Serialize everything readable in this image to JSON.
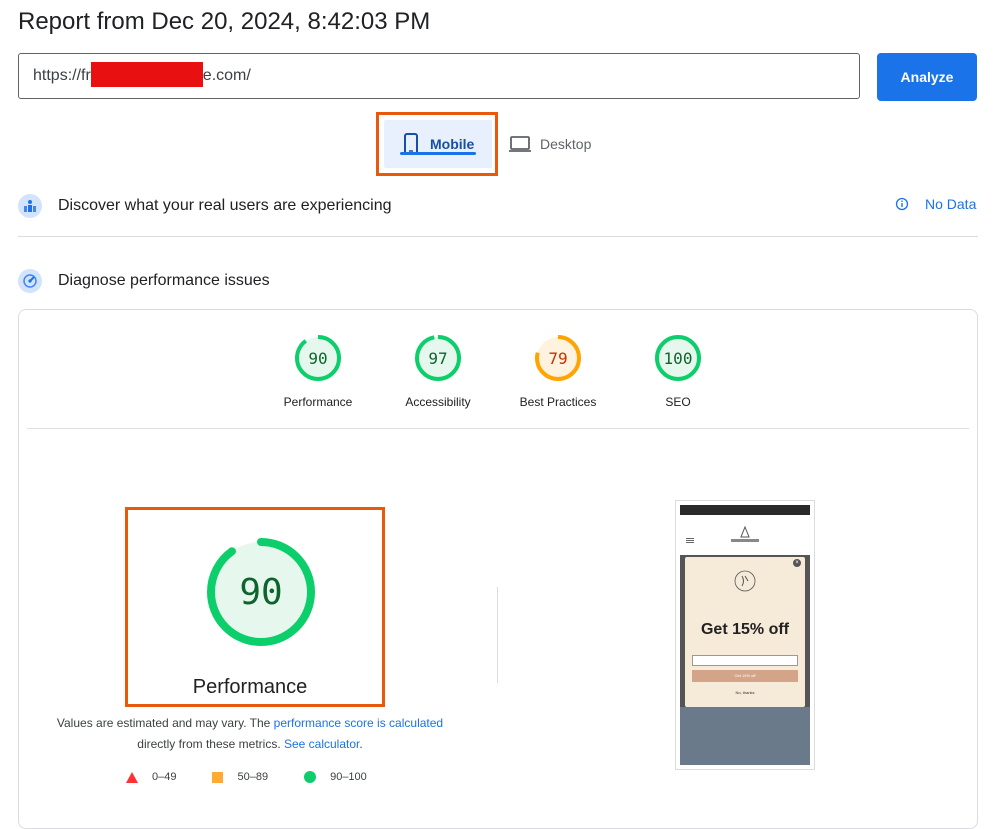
{
  "header": {
    "title": "Report from Dec 20, 2024, 8:42:03 PM"
  },
  "url_bar": {
    "value_prefix": "https://fr",
    "value_suffix": "e.com/",
    "analyze_label": "Analyze"
  },
  "device_tabs": [
    {
      "label": "Mobile",
      "selected": true
    },
    {
      "label": "Desktop",
      "selected": false
    }
  ],
  "field_section": {
    "title": "Discover what your real users are experiencing",
    "no_data": "No Data"
  },
  "lab_section": {
    "title": "Diagnose performance issues"
  },
  "scores": [
    {
      "label": "Performance",
      "value": "90",
      "status": "pass"
    },
    {
      "label": "Accessibility",
      "value": "97",
      "status": "pass"
    },
    {
      "label": "Best Practices",
      "value": "79",
      "status": "average"
    },
    {
      "label": "SEO",
      "value": "100",
      "status": "pass"
    }
  ],
  "performance": {
    "score": "90",
    "label": "Performance",
    "note_part1": "Values are estimated and may vary. The ",
    "note_link1": "performance score is calculated",
    "note_part2": "directly from these metrics. ",
    "note_link2": "See calculator",
    "note_end": "."
  },
  "legend": [
    {
      "range": "0–49",
      "color": "#ff3333"
    },
    {
      "range": "50–89",
      "color": "#ffaa33"
    },
    {
      "range": "90–100",
      "color": "#0cce6b"
    }
  ],
  "screenshot": {
    "popup_headline": "Get 15% off",
    "popup_button": "Get 15% off",
    "popup_decline": "No, thanks"
  },
  "colors": {
    "accent": "#1a73e8",
    "pass": "#0cce6b",
    "average": "#ffa400",
    "highlight": "#e8590c"
  }
}
